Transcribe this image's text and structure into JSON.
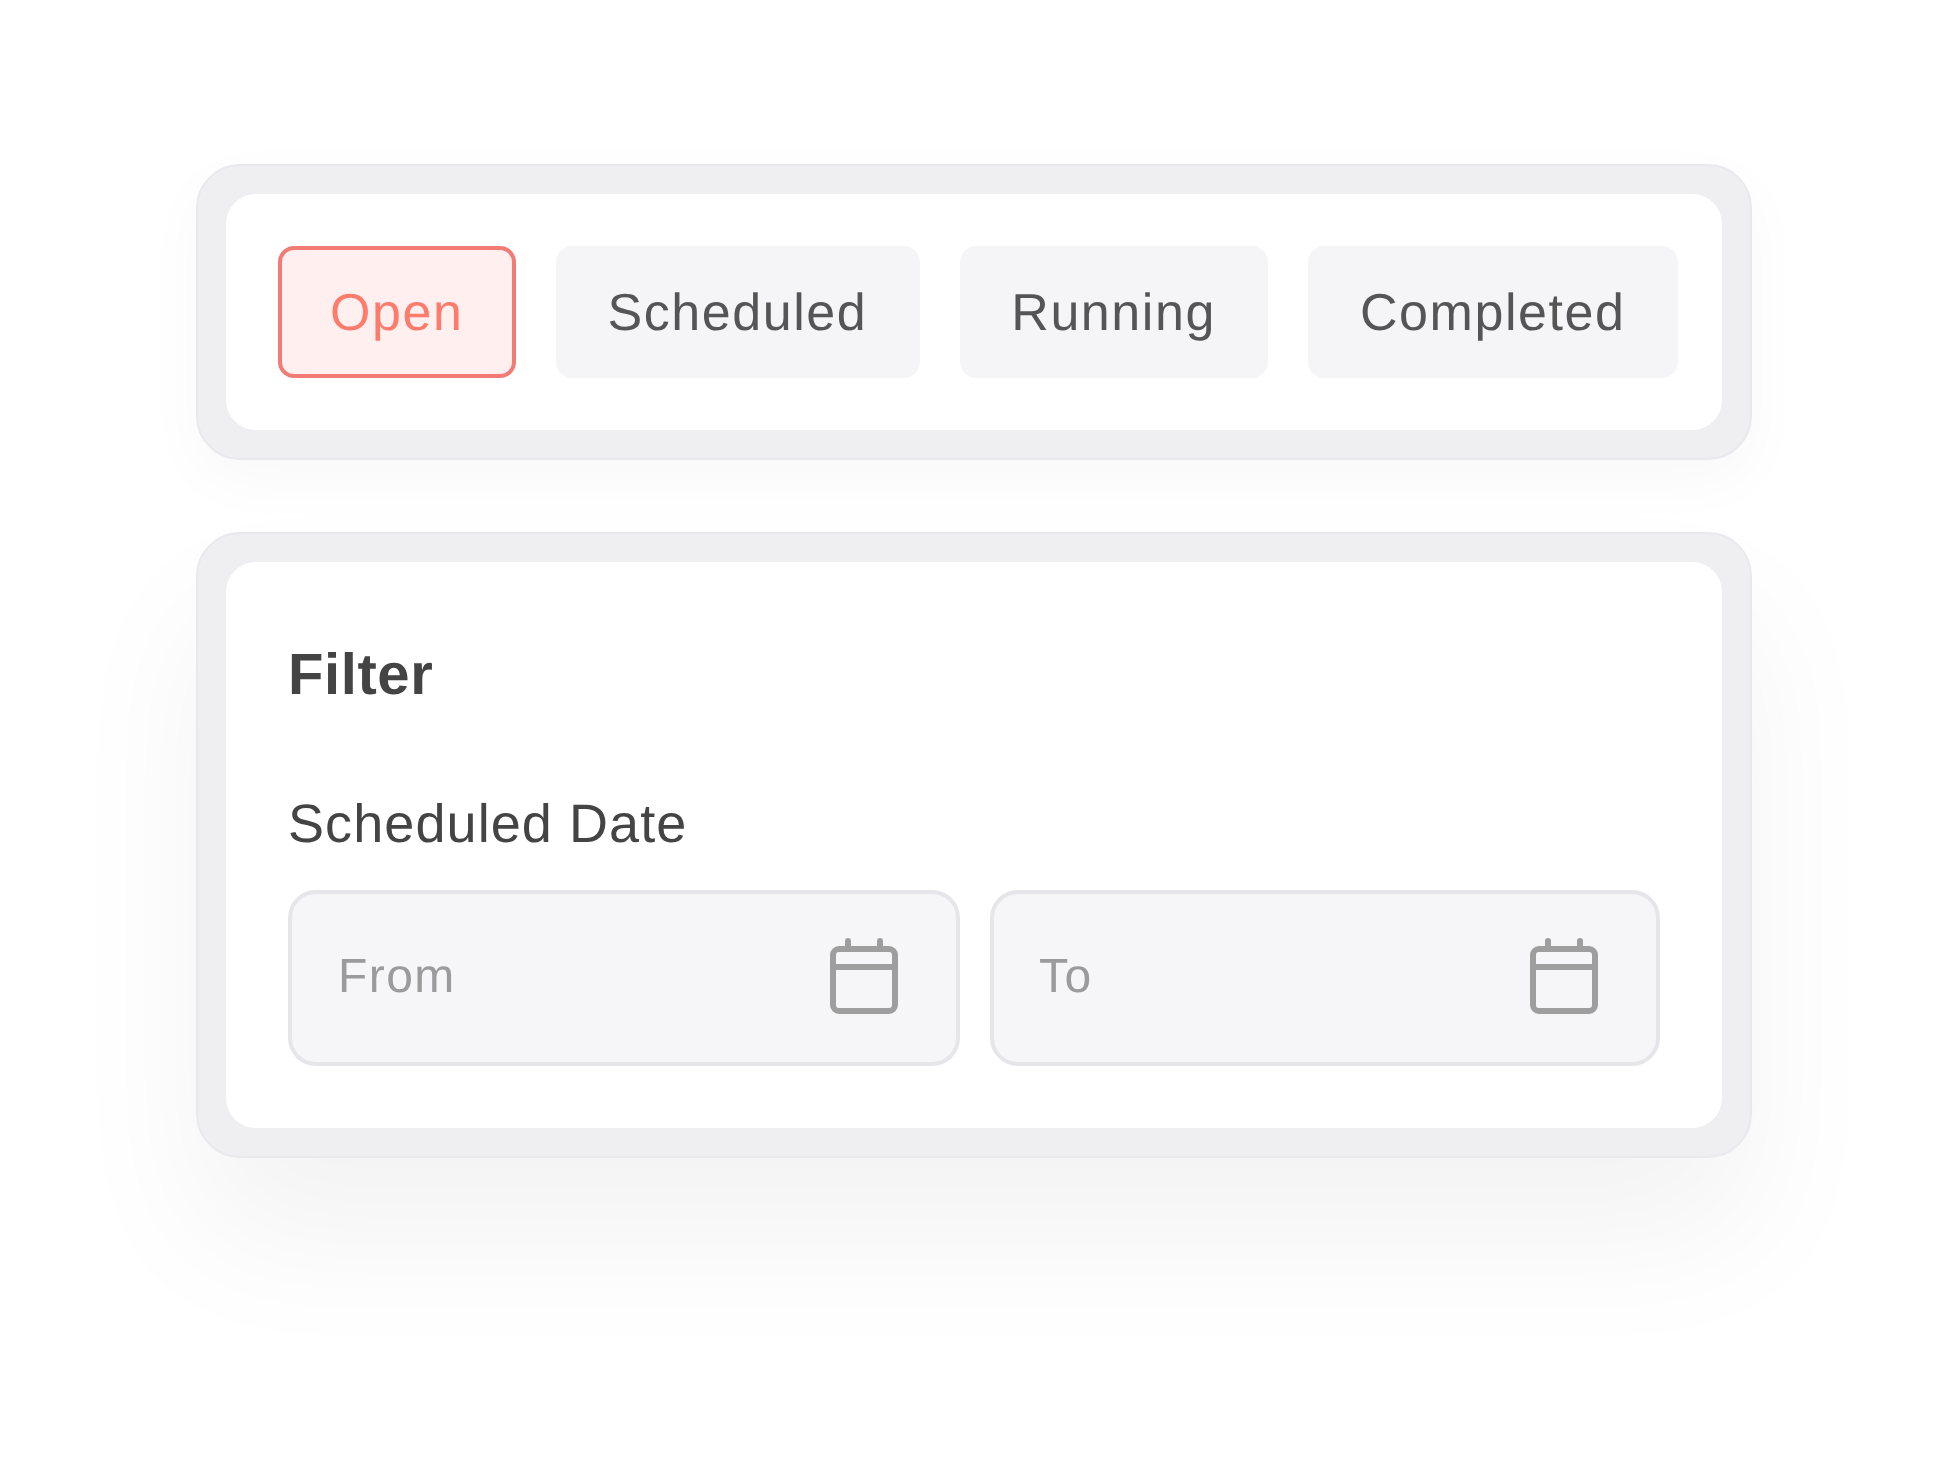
{
  "tabs": [
    {
      "label": "Open",
      "selected": true
    },
    {
      "label": "Scheduled",
      "selected": false
    },
    {
      "label": "Running",
      "selected": false
    },
    {
      "label": "Completed",
      "selected": false
    }
  ],
  "filter": {
    "title": "Filter",
    "sections": [
      {
        "label": "Scheduled Date",
        "fields": [
          {
            "placeholder": "From"
          },
          {
            "placeholder": "To"
          }
        ]
      }
    ]
  }
}
